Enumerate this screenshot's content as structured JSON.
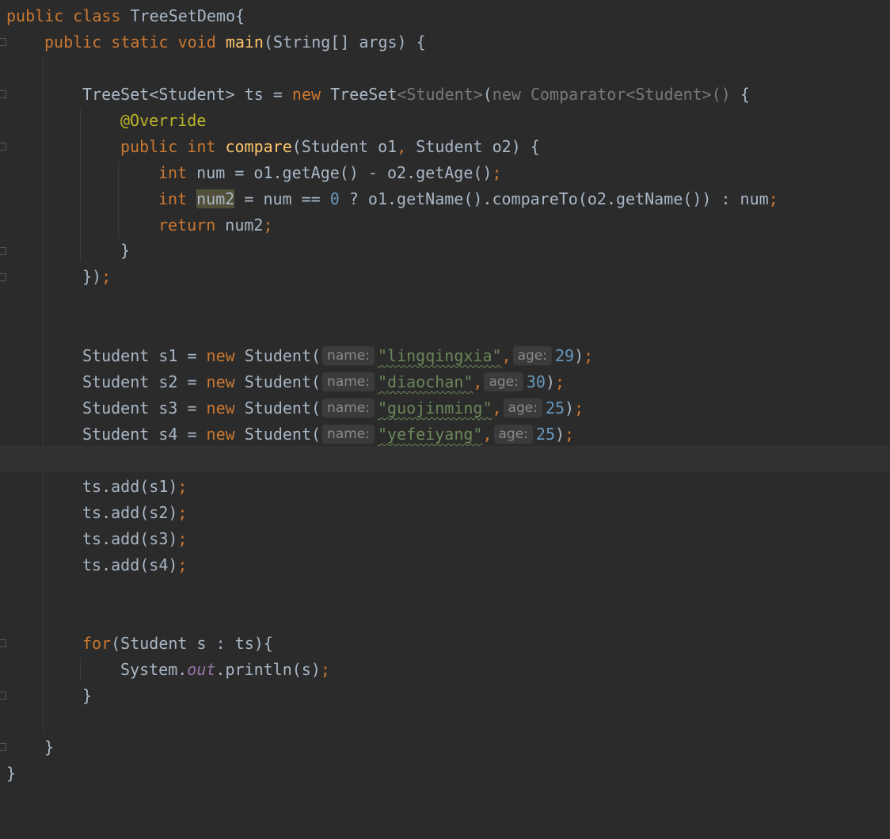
{
  "code": {
    "l1": [
      "public",
      "class",
      "TreeSetDemo",
      "{"
    ],
    "l2": [
      "public",
      "static",
      "void",
      "main",
      "(String[] args) {"
    ],
    "l3": [
      "TreeSet<Student> ts = ",
      "new",
      " TreeSet",
      "<Student>",
      "(",
      "new",
      " Comparator<Student>",
      "()",
      " {"
    ],
    "l4": "@Override",
    "l5": [
      "public",
      "int",
      "compare",
      "(Student o1",
      ",",
      " Student o2) {"
    ],
    "l6": [
      "int",
      " num = o1.getAge() - o2.getAge()",
      ";"
    ],
    "l7": [
      "int",
      " ",
      "num2",
      " = num == ",
      "0",
      " ? o1.getName().compareTo(o2.getName()) : num",
      ";"
    ],
    "l8": [
      "return",
      " num2",
      ";"
    ],
    "l9": "}",
    "l10": [
      "})",
      ";"
    ],
    "s1": [
      "Student s1 = ",
      "new",
      " Student(",
      "name:",
      "\"lingqingxia\"",
      ",",
      "age:",
      "29",
      ")",
      ";"
    ],
    "s2": [
      "Student s2 = ",
      "new",
      " Student(",
      "name:",
      "\"diaochan\"",
      ",",
      "age:",
      "30",
      ")",
      ";"
    ],
    "s3": [
      "Student s3 = ",
      "new",
      " Student(",
      "name:",
      "\"guojinming\"",
      ",",
      "age:",
      "25",
      ")",
      ";"
    ],
    "s4": [
      "Student s4 = ",
      "new",
      " Student(",
      "name:",
      "\"yefeiyang\"",
      ",",
      "age:",
      "25",
      ")",
      ";"
    ],
    "a1": [
      "ts.add(s1)",
      ";"
    ],
    "a2": [
      "ts.add(s2)",
      ";"
    ],
    "a3": [
      "ts.add(s3)",
      ";"
    ],
    "a4": [
      "ts.add(s4)",
      ";"
    ],
    "f1": [
      "for",
      "(Student s : ts){"
    ],
    "f2": [
      "System.",
      "out",
      ".println(s)",
      ";"
    ],
    "f3": "}",
    "c1": "}",
    "c2": "}"
  },
  "colors": {
    "background": "#2b2b2b",
    "keyword": "#cc7832",
    "method": "#ffc66d",
    "string": "#6a8759",
    "number": "#6897bb",
    "annotation": "#bbb529",
    "text": "#a9b7c6"
  }
}
